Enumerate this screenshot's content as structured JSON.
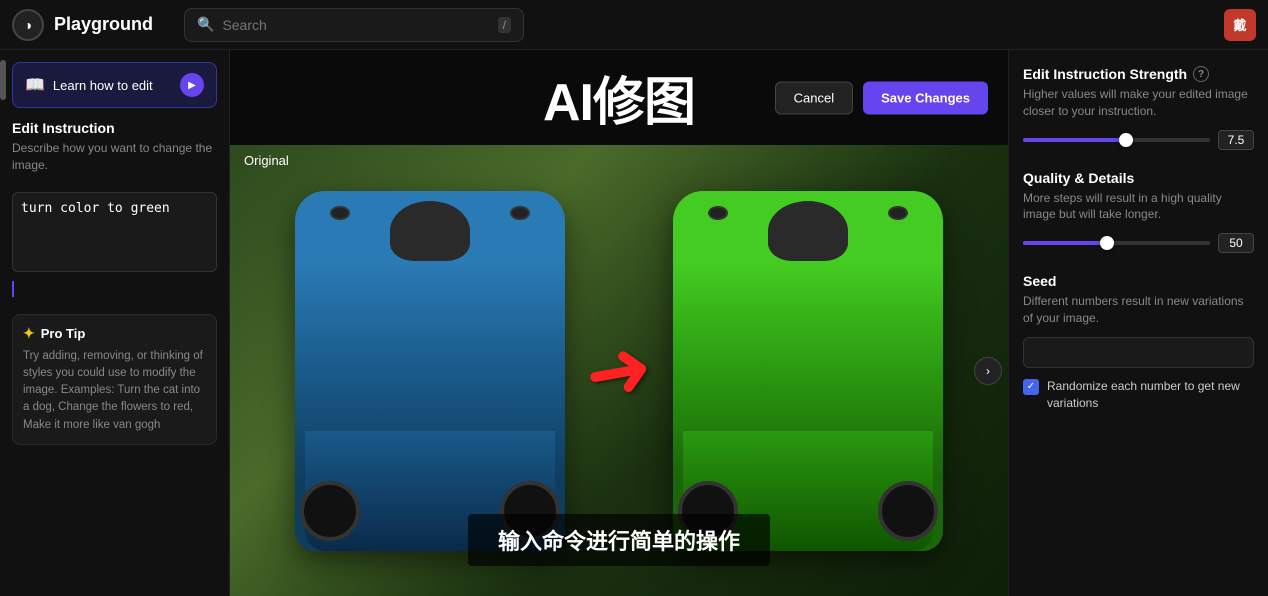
{
  "nav": {
    "logo_icon": "◑",
    "logo_text": "Playground",
    "search_placeholder": "Search",
    "slash_key": "/",
    "user_initials": "戴"
  },
  "left_panel": {
    "learn_btn_label": "Learn how to edit",
    "play_icon": "▶",
    "book_icon": "📖",
    "edit_instruction": {
      "title": "Edit Instruction",
      "description": "Describe how you want to change the image.",
      "textarea_value": "turn color to green"
    },
    "pro_tip": {
      "icon": "✦",
      "title": "Pro Tip",
      "text": "Try adding, removing, or thinking of styles you could use to modify the image. Examples: Turn the cat into a dog, Change the flowers to red, Make it more like van gogh"
    }
  },
  "center": {
    "title": "AI修图",
    "cancel_label": "Cancel",
    "save_label": "Save Changes",
    "original_label": "Original",
    "bottom_text": "输入命令进行简单的操作",
    "arrow": "➜"
  },
  "right_panel": {
    "strength_section": {
      "title": "Edit Instruction Strength",
      "desc": "Higher values will make your edited image closer to your instruction.",
      "value": 7.5,
      "fill_percent": 55
    },
    "quality_section": {
      "title": "Quality & Details",
      "desc": "More steps will result in a high quality image but will take longer.",
      "value": 50,
      "fill_percent": 45
    },
    "seed_section": {
      "title": "Seed",
      "desc": "Different numbers result in new variations of your image.",
      "input_placeholder": ""
    },
    "randomize": {
      "checked": true,
      "label": "Randomize each number to get new variations",
      "check_icon": "✓"
    }
  }
}
